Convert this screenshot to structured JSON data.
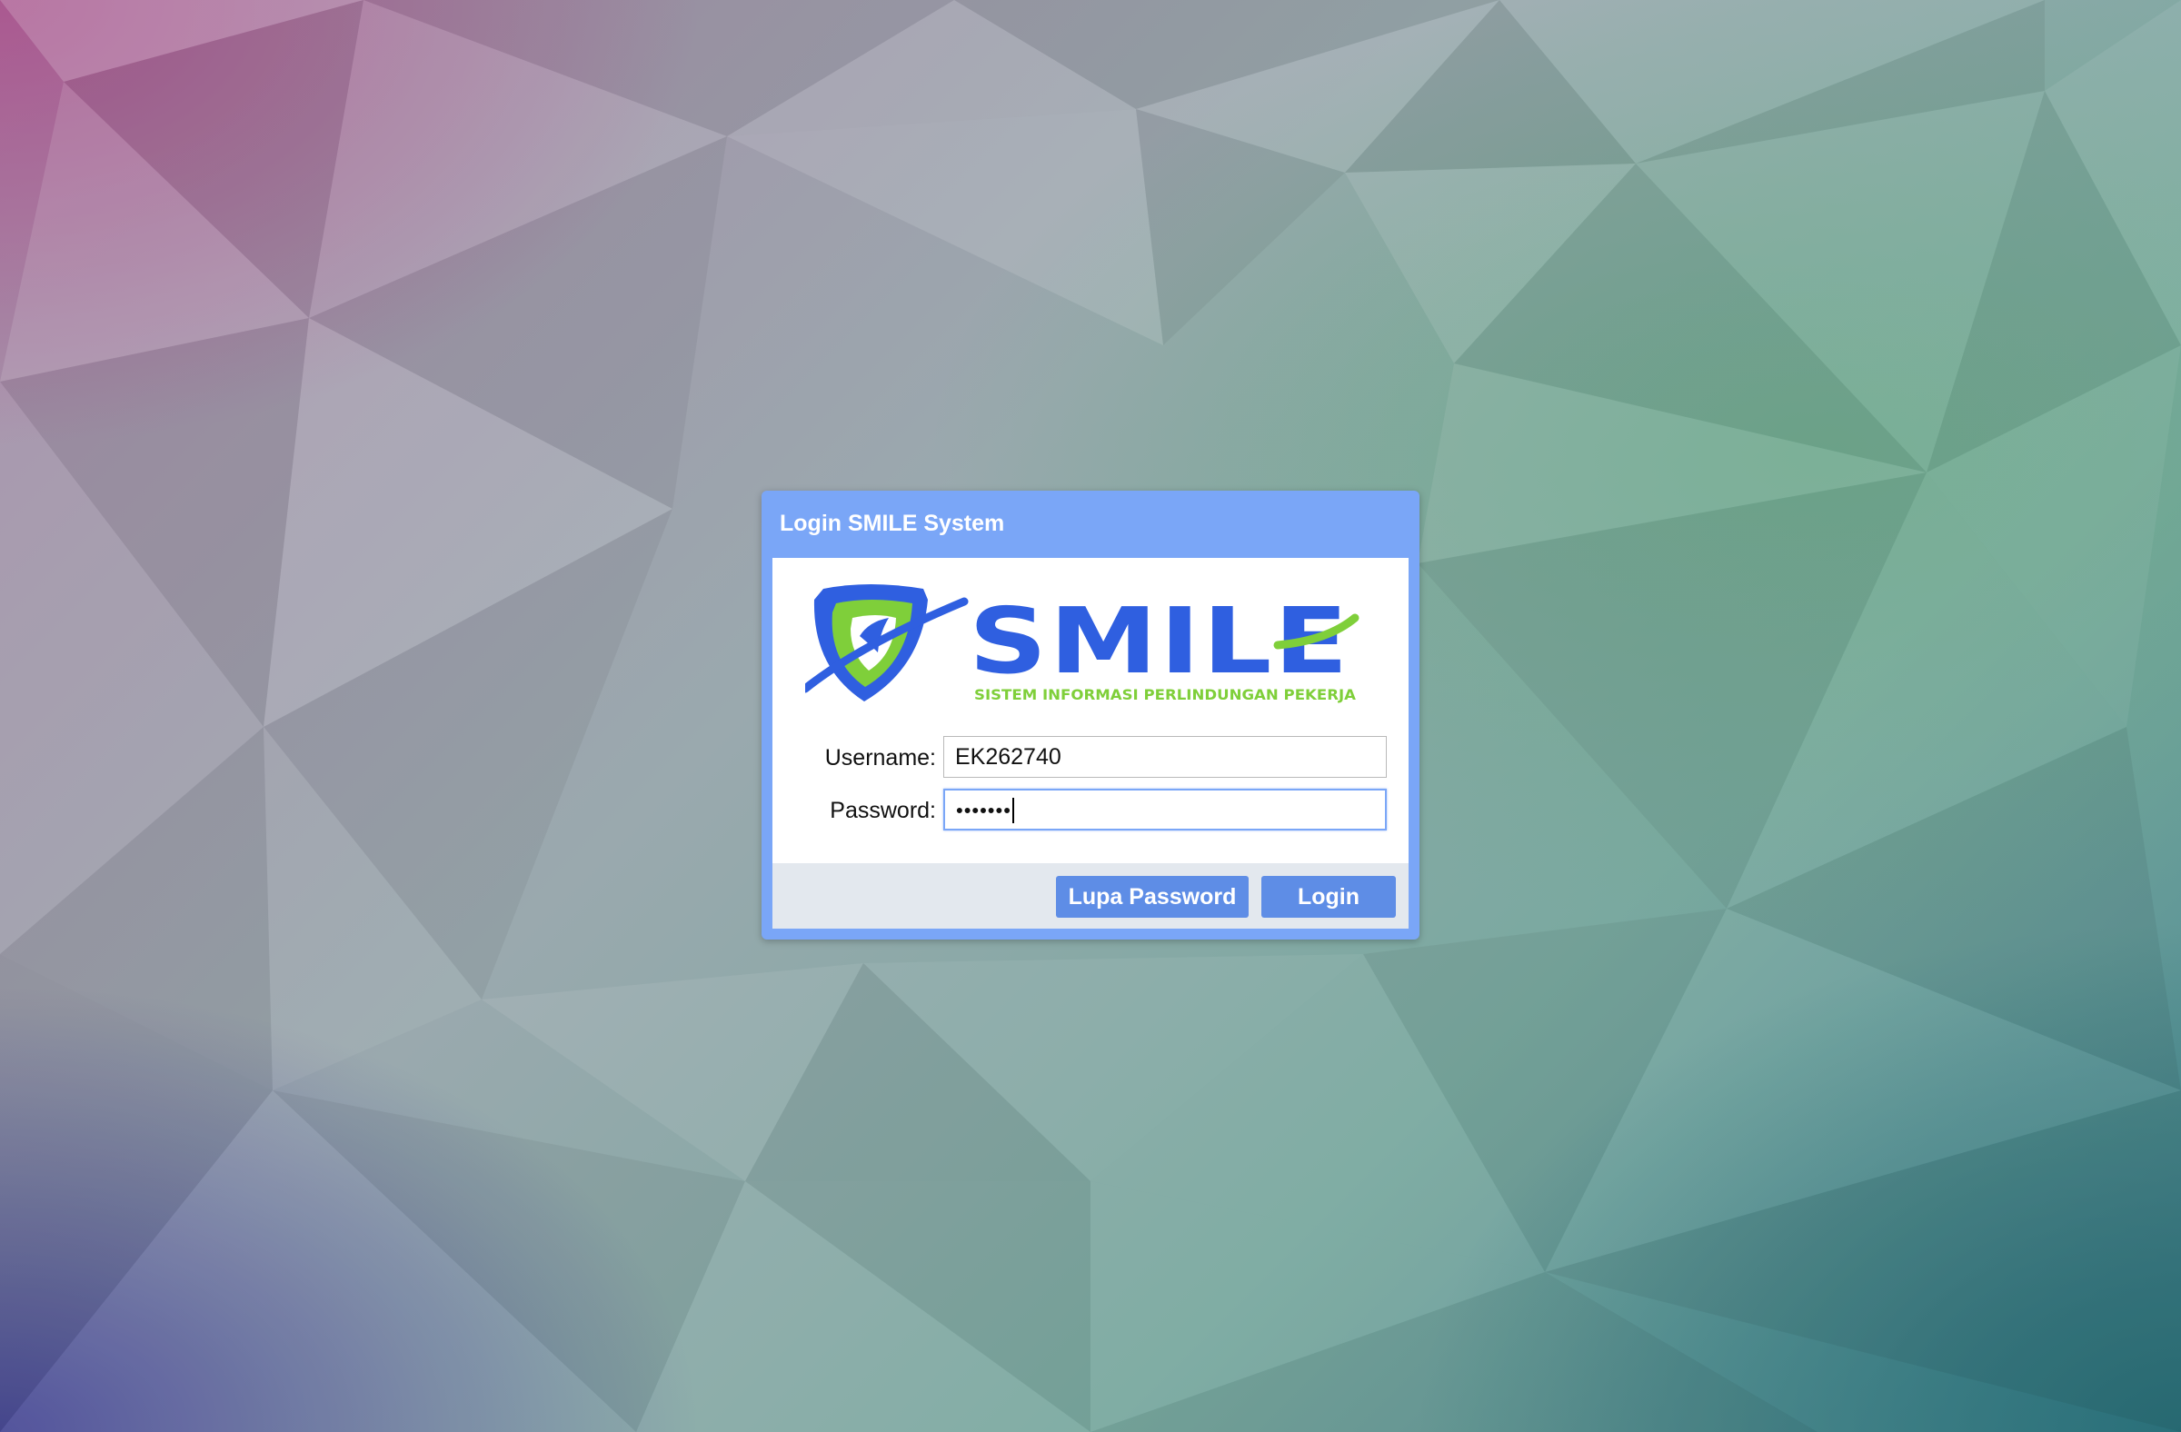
{
  "dialog": {
    "title": "Login SMILE System"
  },
  "logo": {
    "wordmark": "SMILE",
    "tagline": "SISTEM INFORMASI PERLINDUNGAN PEKERJA",
    "icon": "shield-icon"
  },
  "form": {
    "username_label": "Username:",
    "username_value": "EK262740",
    "password_label": "Password:",
    "password_value": "•••••••"
  },
  "buttons": {
    "forgot_password": "Lupa Password",
    "login": "Login"
  },
  "colors": {
    "dialog_header": "#7aa6f7",
    "button": "#5e8de6",
    "button_bar": "#e3e8ee",
    "logo_blue": "#2f5fe0",
    "logo_green": "#7fcf3a"
  }
}
